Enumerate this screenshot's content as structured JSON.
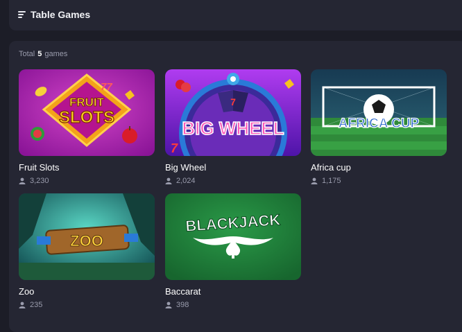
{
  "header": {
    "title": "Table Games",
    "menu_icon": "hamburger-icon"
  },
  "summary": {
    "prefix": "Total",
    "count": "5",
    "suffix": "games"
  },
  "games": [
    {
      "name": "Fruit Slots",
      "players": "3,230",
      "art_text_top": "FRUIT",
      "art_text_bottom": "SLOTS",
      "art_badge": "77"
    },
    {
      "name": "Big Wheel",
      "players": "2,024",
      "art_text": "BIG WHEEL",
      "art_wheel_value": "7",
      "art_badge": "7"
    },
    {
      "name": "Africa cup",
      "players": "1,175",
      "art_text": "AFRICA CUP"
    },
    {
      "name": "Zoo",
      "players": "235",
      "art_text": "ZOO"
    },
    {
      "name": "Baccarat",
      "players": "398",
      "art_text": "BLACKJACK"
    }
  ],
  "colors": {
    "background": "#1c1d27",
    "panel": "#252633",
    "muted_text": "#9a9cad",
    "fruit_slots_bg": "#a31fa8",
    "big_wheel_bg": "#7a1ec9",
    "africa_cup_bg": "#1f8a3a",
    "zoo_bg": "#1f7a7f",
    "baccarat_bg": "#1e8a3a"
  }
}
